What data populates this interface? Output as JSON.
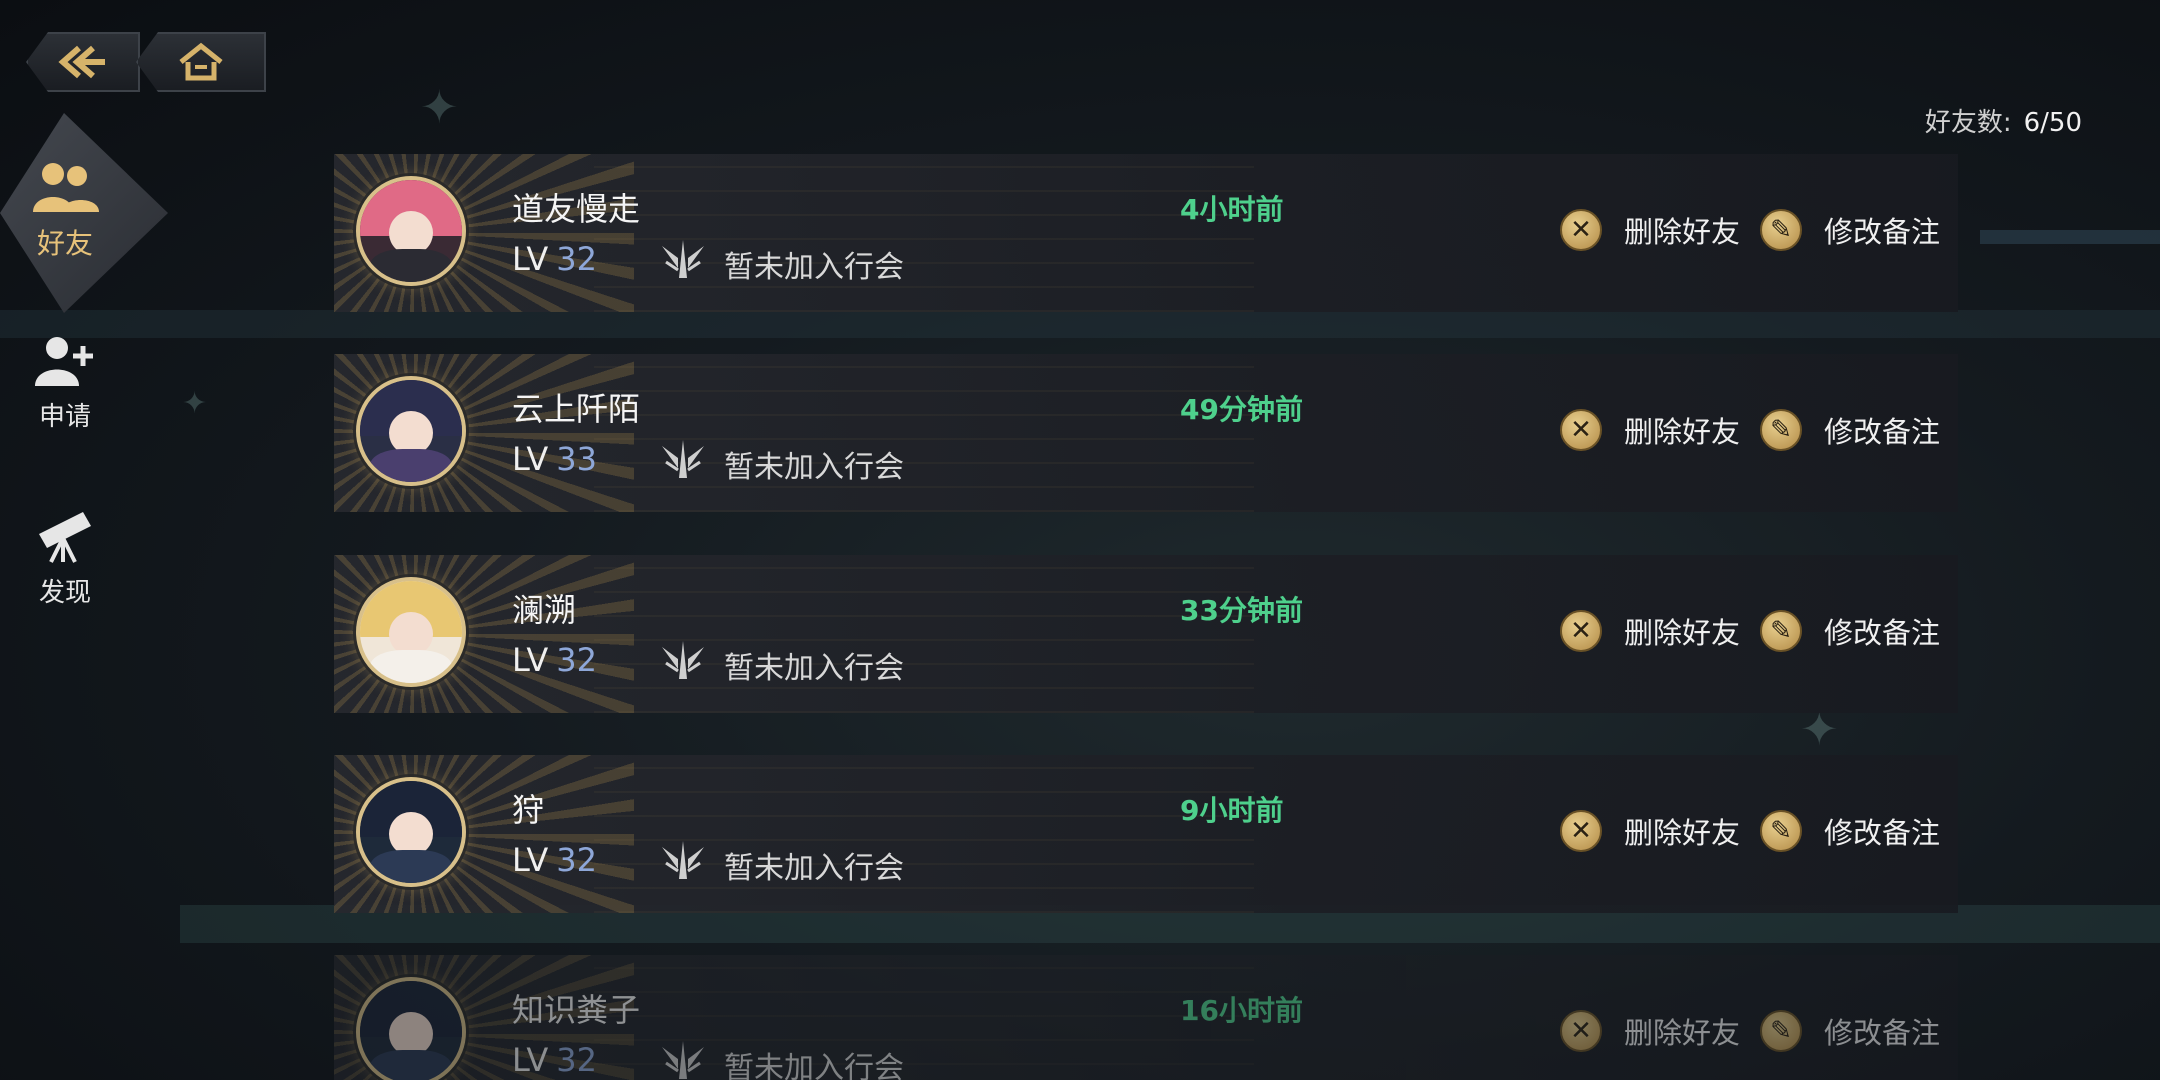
{
  "nav": {
    "back_icon": "back-arrow-icon",
    "home_icon": "home-icon"
  },
  "friend_count": {
    "label": "好友数:",
    "value": "6/50"
  },
  "sidebar": {
    "items": [
      {
        "label": "好友",
        "icon": "friends-icon",
        "active": true
      },
      {
        "label": "申请",
        "icon": "add-friend-icon",
        "active": false
      },
      {
        "label": "发现",
        "icon": "telescope-icon",
        "active": false
      }
    ]
  },
  "friends": [
    {
      "name": "道友慢走",
      "lv_prefix": "LV",
      "level": "32",
      "guild": "暂未加入行会",
      "last_online": "4小时前",
      "delete_label": "删除好友",
      "remark_label": "修改备注"
    },
    {
      "name": "云上阡陌",
      "lv_prefix": "LV",
      "level": "33",
      "guild": "暂未加入行会",
      "last_online": "49分钟前",
      "delete_label": "删除好友",
      "remark_label": "修改备注"
    },
    {
      "name": "澜溯",
      "lv_prefix": "LV",
      "level": "32",
      "guild": "暂未加入行会",
      "last_online": "33分钟前",
      "delete_label": "删除好友",
      "remark_label": "修改备注"
    },
    {
      "name": "狩",
      "lv_prefix": "LV",
      "level": "32",
      "guild": "暂未加入行会",
      "last_online": "9小时前",
      "delete_label": "删除好友",
      "remark_label": "修改备注"
    },
    {
      "name": "知识粪子",
      "lv_prefix": "LV",
      "level": "32",
      "guild": "暂未加入行会",
      "last_online": "16小时前",
      "delete_label": "删除好友",
      "remark_label": "修改备注"
    }
  ],
  "colors": {
    "accent_gold": "#e7c27a",
    "online_green": "#4ed08c",
    "level_blue": "#8ea7d8"
  }
}
